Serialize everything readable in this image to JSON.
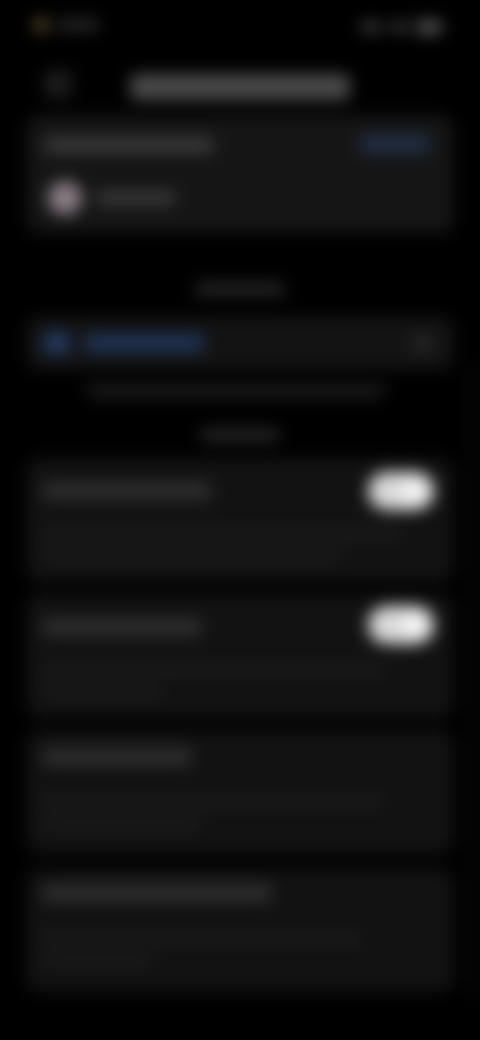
{
  "status_bar": {
    "left_icon": "app-icon",
    "right_icons": [
      "signal-icon",
      "wifi-icon",
      "battery-icon"
    ]
  },
  "header": {
    "back_icon": "chevron-left-icon"
  },
  "account_card": {
    "avatar_icon": "avatar-icon"
  },
  "link_row": {
    "icon": "link-icon",
    "chevron_icon": "chevron-right-icon"
  },
  "settings": {
    "rows": [
      {
        "toggle_state": "on"
      },
      {
        "toggle_state": "on"
      },
      {},
      {}
    ]
  },
  "colors": {
    "background": "#000000",
    "card": "#141414",
    "accent": "#233b63",
    "toggle_on": "#d9d9d9"
  }
}
